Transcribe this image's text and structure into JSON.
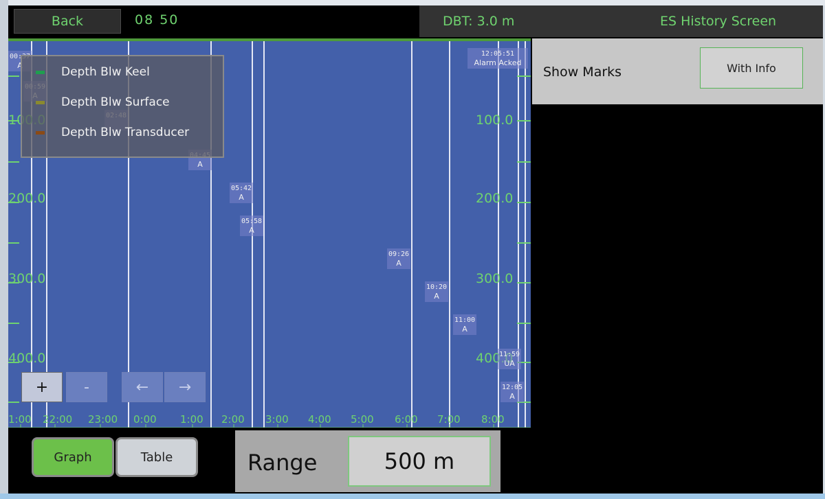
{
  "header": {
    "back_label": "Back",
    "time": "08 50",
    "dbt": "DBT: 3.0 m",
    "screen_title": "ES History Screen"
  },
  "legend": [
    {
      "label": "Depth Blw Keel",
      "color": "#1f9e4f"
    },
    {
      "label": "Depth Blw Surface",
      "color": "#8a8a2e"
    },
    {
      "label": "Depth Blw Transducer",
      "color": "#8a4a16"
    }
  ],
  "graph": {
    "background": "#4360aa",
    "left_axis_labels": [
      "100.0",
      "200.0",
      "300.0",
      "400.0"
    ],
    "right_axis_labels": [
      "100.0",
      "200.0",
      "300.0",
      "400.0"
    ],
    "time_labels": [
      "1:00",
      "22:00",
      "23:00",
      "0:00",
      "1:00",
      "2:00",
      "3:00",
      "4:00",
      "5:00",
      "6:00",
      "7:00",
      "8:00"
    ],
    "marks": [
      {
        "time": "00:37",
        "code": "A"
      },
      {
        "time": "00:59",
        "code": "A"
      },
      {
        "time": "02:48",
        "code": ""
      },
      {
        "time": "04:45",
        "code": "A"
      },
      {
        "time": "05:42",
        "code": "A"
      },
      {
        "time": "05:58",
        "code": "A"
      },
      {
        "time": "09:26",
        "code": "A"
      },
      {
        "time": "10:20",
        "code": "A"
      },
      {
        "time": "11:00",
        "code": "A"
      },
      {
        "time": "11:59",
        "code": "UA"
      },
      {
        "time": "12:05",
        "code": "A"
      },
      {
        "time": "12:05:51",
        "code": "Alarm Acked"
      }
    ],
    "controls": {
      "zoom_in": "+",
      "zoom_out": "-",
      "scroll_left": "←",
      "scroll_right": "→"
    }
  },
  "marks_panel": {
    "label": "Show Marks",
    "button": "With Info"
  },
  "bottom": {
    "graph_label": "Graph",
    "table_label": "Table",
    "range_label": "Range",
    "range_value": "500 m"
  }
}
